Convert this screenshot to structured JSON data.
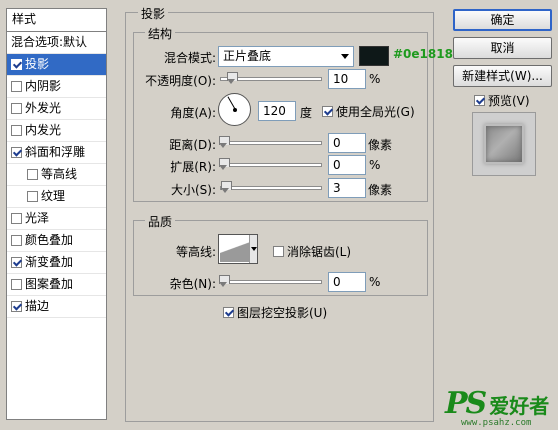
{
  "left_panel": {
    "header": "样式",
    "items": [
      {
        "label": "混合选项:默认",
        "checkbox": false,
        "checked": false,
        "indent": false,
        "selected": false
      },
      {
        "label": "投影",
        "checkbox": true,
        "checked": true,
        "indent": false,
        "selected": true
      },
      {
        "label": "内阴影",
        "checkbox": true,
        "checked": false,
        "indent": false,
        "selected": false
      },
      {
        "label": "外发光",
        "checkbox": true,
        "checked": false,
        "indent": false,
        "selected": false
      },
      {
        "label": "内发光",
        "checkbox": true,
        "checked": false,
        "indent": false,
        "selected": false
      },
      {
        "label": "斜面和浮雕",
        "checkbox": true,
        "checked": true,
        "indent": false,
        "selected": false
      },
      {
        "label": "等高线",
        "checkbox": true,
        "checked": false,
        "indent": true,
        "selected": false
      },
      {
        "label": "纹理",
        "checkbox": true,
        "checked": false,
        "indent": true,
        "selected": false
      },
      {
        "label": "光泽",
        "checkbox": true,
        "checked": false,
        "indent": false,
        "selected": false
      },
      {
        "label": "颜色叠加",
        "checkbox": true,
        "checked": false,
        "indent": false,
        "selected": false
      },
      {
        "label": "渐变叠加",
        "checkbox": true,
        "checked": true,
        "indent": false,
        "selected": false
      },
      {
        "label": "图案叠加",
        "checkbox": true,
        "checked": false,
        "indent": false,
        "selected": false
      },
      {
        "label": "描边",
        "checkbox": true,
        "checked": true,
        "indent": false,
        "selected": false
      }
    ]
  },
  "buttons": {
    "ok": "确定",
    "cancel": "取消",
    "new_style": "新建样式(W)...",
    "preview": "预览(V)"
  },
  "drop_shadow": {
    "title": "投影",
    "structure": {
      "title": "结构",
      "blend_mode_label": "混合模式:",
      "blend_mode_value": "正片叠底",
      "color_hex": "#0e1818",
      "opacity_label": "不透明度(O):",
      "opacity_value": "10",
      "angle_label": "角度(A):",
      "angle_value": "120",
      "angle_unit": "度",
      "global_light_label": "使用全局光(G)",
      "distance_label": "距离(D):",
      "distance_value": "0",
      "spread_label": "扩展(R):",
      "spread_value": "0",
      "size_label": "大小(S):",
      "size_value": "3",
      "unit_px": "像素",
      "unit_percent": "%"
    },
    "quality": {
      "title": "品质",
      "contour_label": "等高线:",
      "anti_alias_label": "消除锯齿(L)",
      "noise_label": "杂色(N):",
      "noise_value": "0",
      "unit_percent": "%"
    },
    "knockout_label": "图层挖空投影(U)"
  },
  "watermark": {
    "logo": "PS",
    "text": "爱好者",
    "url": "www.psahz.com"
  }
}
